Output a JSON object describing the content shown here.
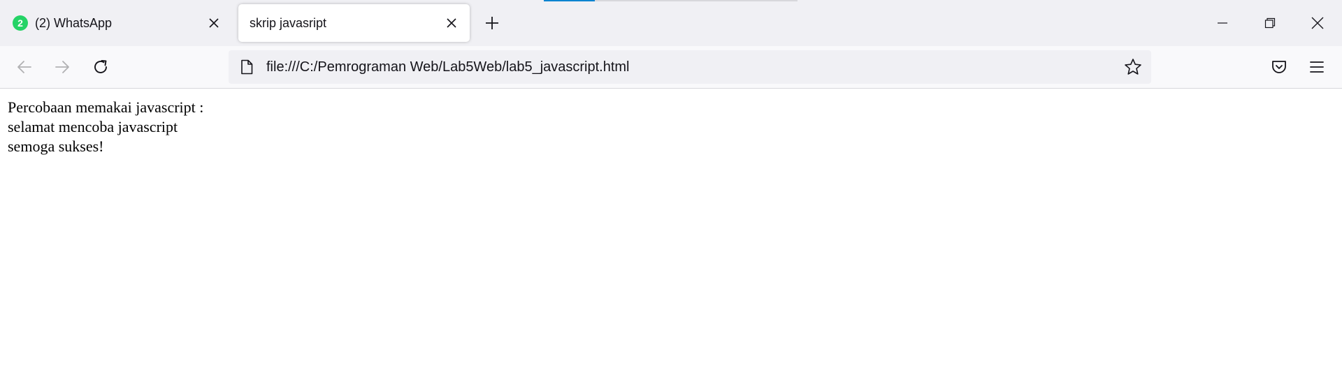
{
  "tabs": [
    {
      "title": "(2) WhatsApp",
      "badge": "2",
      "active": false
    },
    {
      "title": "skrip javasript",
      "active": true
    }
  ],
  "window_controls": {
    "minimize_icon": "minimize-icon",
    "maximize_icon": "restore-icon",
    "close_icon": "close-icon"
  },
  "navigation": {
    "back_icon": "arrow-left-icon",
    "forward_icon": "arrow-right-icon",
    "reload_icon": "reload-icon",
    "url": "file:///C:/Pemrograman Web/Lab5Web/lab5_javascript.html",
    "bookmark_icon": "star-icon",
    "pocket_icon": "pocket-icon",
    "menu_icon": "hamburger-icon"
  },
  "page": {
    "lines": [
      "Percobaan memakai javascript :",
      "selamat mencoba javascript",
      "semoga sukses!"
    ]
  },
  "colors": {
    "accent": "#0a84d0",
    "whatsapp_badge": "#25d366",
    "tabstrip_bg": "#f0f0f4",
    "toolbar_bg": "#f9f9fb"
  }
}
